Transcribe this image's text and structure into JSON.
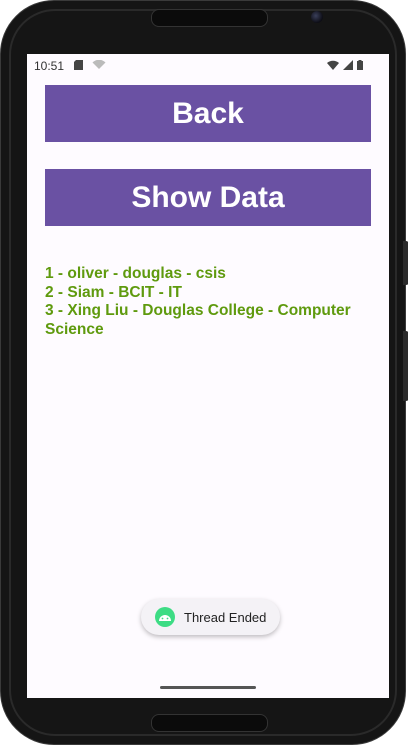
{
  "statusbar": {
    "time": "10:51"
  },
  "buttons": {
    "back_label": "Back",
    "show_data_label": "Show Data"
  },
  "data_lines": [
    "1 - oliver - douglas - csis",
    "2 - Siam - BCIT - IT",
    "3 - Xing Liu - Douglas College - Computer Science"
  ],
  "toast": {
    "message": "Thread Ended"
  },
  "colors": {
    "button_bg": "#6a51a3",
    "data_text": "#5f9a0e",
    "screen_bg": "#fefbff"
  }
}
